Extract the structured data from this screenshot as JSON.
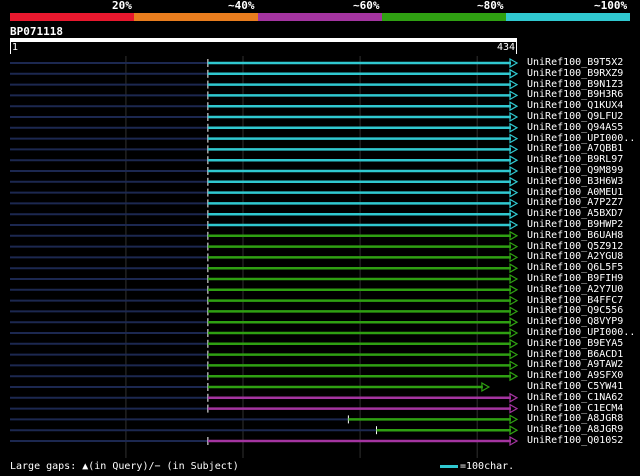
{
  "scale": {
    "labels": [
      "20%",
      "~40%",
      "~60%",
      "~80%",
      "~100%"
    ],
    "colors": [
      "#e8182e",
      "#e87d1e",
      "#a434a0",
      "#2fa012",
      "#30c8d0"
    ]
  },
  "query": {
    "name": "BP071118",
    "length": 434,
    "start_label": "1",
    "end_label": "434"
  },
  "hits": [
    {
      "label": "UniRef100_B9T5X2",
      "color": "#30c8d0",
      "start": 170,
      "end": 434
    },
    {
      "label": "UniRef100_B9RXZ9",
      "color": "#30c8d0",
      "start": 170,
      "end": 434
    },
    {
      "label": "UniRef100_B9N1Z3",
      "color": "#30c8d0",
      "start": 170,
      "end": 434
    },
    {
      "label": "UniRef100_B9H3R6",
      "color": "#30c8d0",
      "start": 170,
      "end": 434
    },
    {
      "label": "UniRef100_Q1KUX4",
      "color": "#30c8d0",
      "start": 170,
      "end": 434
    },
    {
      "label": "UniRef100_Q9LFU2",
      "color": "#30c8d0",
      "start": 170,
      "end": 434
    },
    {
      "label": "UniRef100_Q94AS5",
      "color": "#30c8d0",
      "start": 170,
      "end": 434
    },
    {
      "label": "UniRef100_UPI000..",
      "color": "#30c8d0",
      "start": 170,
      "end": 434
    },
    {
      "label": "UniRef100_A7QBB1",
      "color": "#30c8d0",
      "start": 170,
      "end": 434
    },
    {
      "label": "UniRef100_B9RL97",
      "color": "#30c8d0",
      "start": 170,
      "end": 434
    },
    {
      "label": "UniRef100_Q9M899",
      "color": "#30c8d0",
      "start": 170,
      "end": 434
    },
    {
      "label": "UniRef100_B3H6W3",
      "color": "#30c8d0",
      "start": 170,
      "end": 434
    },
    {
      "label": "UniRef100_A0MEU1",
      "color": "#30c8d0",
      "start": 170,
      "end": 434
    },
    {
      "label": "UniRef100_A7P2Z7",
      "color": "#30c8d0",
      "start": 170,
      "end": 434
    },
    {
      "label": "UniRef100_A5BXD7",
      "color": "#30c8d0",
      "start": 170,
      "end": 434
    },
    {
      "label": "UniRef100_B9HWP2",
      "color": "#30c8d0",
      "start": 170,
      "end": 434
    },
    {
      "label": "UniRef100_B6UAH8",
      "color": "#2fa012",
      "start": 170,
      "end": 434
    },
    {
      "label": "UniRef100_Q5Z912",
      "color": "#2fa012",
      "start": 170,
      "end": 434
    },
    {
      "label": "UniRef100_A2YGU8",
      "color": "#2fa012",
      "start": 170,
      "end": 434
    },
    {
      "label": "UniRef100_Q6L5F5",
      "color": "#2fa012",
      "start": 170,
      "end": 434
    },
    {
      "label": "UniRef100_B9FIH9",
      "color": "#2fa012",
      "start": 170,
      "end": 434
    },
    {
      "label": "UniRef100_A2Y7U0",
      "color": "#2fa012",
      "start": 170,
      "end": 434
    },
    {
      "label": "UniRef100_B4FFC7",
      "color": "#2fa012",
      "start": 170,
      "end": 434
    },
    {
      "label": "UniRef100_Q9C556",
      "color": "#2fa012",
      "start": 170,
      "end": 434
    },
    {
      "label": "UniRef100_Q8VYP9",
      "color": "#2fa012",
      "start": 170,
      "end": 434
    },
    {
      "label": "UniRef100_UPI000..",
      "color": "#2fa012",
      "start": 170,
      "end": 434
    },
    {
      "label": "UniRef100_B9EYA5",
      "color": "#2fa012",
      "start": 170,
      "end": 434
    },
    {
      "label": "UniRef100_B6ACD1",
      "color": "#2fa012",
      "start": 170,
      "end": 434
    },
    {
      "label": "UniRef100_A9TAW2",
      "color": "#2fa012",
      "start": 170,
      "end": 434
    },
    {
      "label": "UniRef100_A9SFX0",
      "color": "#2fa012",
      "start": 170,
      "end": 434
    },
    {
      "label": "UniRef100_C5YW41",
      "color": "#2fa012",
      "start": 170,
      "end": 410
    },
    {
      "label": "UniRef100_C1NA62",
      "color": "#a434a0",
      "start": 170,
      "end": 434
    },
    {
      "label": "UniRef100_C1ECM4",
      "color": "#a434a0",
      "start": 170,
      "end": 434
    },
    {
      "label": "UniRef100_A8JGR8",
      "color": "#2fa012",
      "start": 290,
      "end": 434
    },
    {
      "label": "UniRef100_A8JGR9",
      "color": "#2fa012",
      "start": 314,
      "end": 434
    },
    {
      "label": "UniRef100_Q010S2",
      "color": "#a434a0",
      "start": 170,
      "end": 434
    }
  ],
  "footer": {
    "gaps_text": "Large gaps: ▲(in Query)/− (in Subject)",
    "legend_text": "=100char."
  }
}
